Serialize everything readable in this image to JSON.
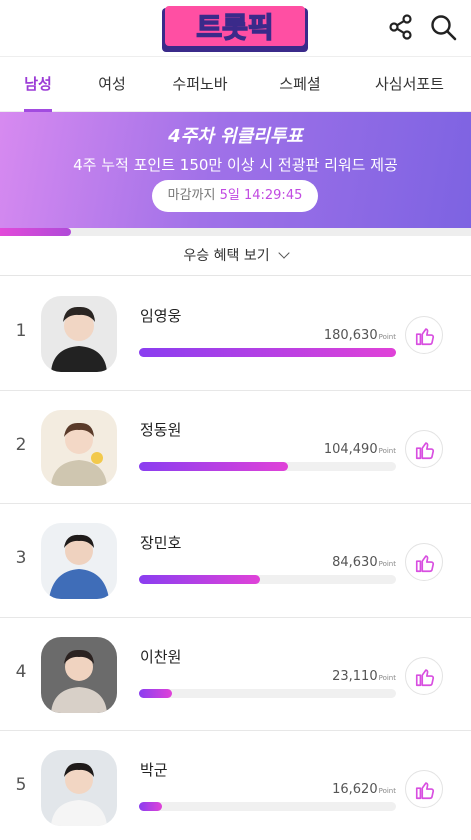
{
  "header": {
    "logo_text": "트롯픽",
    "share_icon": "share-icon",
    "search_icon": "search-icon"
  },
  "tabs": [
    {
      "label": "남성",
      "active": true
    },
    {
      "label": "여성",
      "active": false
    },
    {
      "label": "수퍼노바",
      "active": false
    },
    {
      "label": "스페셜",
      "active": false
    },
    {
      "label": "사심서포트",
      "active": false
    }
  ],
  "banner": {
    "title": "4주차 위클리투표",
    "subtitle": "4주 누적 포인트 150만 이상 시 전광판 리워드 제공",
    "deadline_label": "마감까지",
    "deadline_time": "5일 14:29:45",
    "progress": 0.15
  },
  "benefit": {
    "label": "우승 혜택 보기",
    "icon": "chevron-down-icon"
  },
  "ranking": [
    {
      "rank": "1",
      "name": "임영웅",
      "points": "180,630",
      "unit": "Point",
      "share": 1.0
    },
    {
      "rank": "2",
      "name": "정동원",
      "points": "104,490",
      "unit": "Point",
      "share": 0.58
    },
    {
      "rank": "3",
      "name": "장민호",
      "points": "84,630",
      "unit": "Point",
      "share": 0.47
    },
    {
      "rank": "4",
      "name": "이찬원",
      "points": "23,110",
      "unit": "Point",
      "share": 0.13
    },
    {
      "rank": "5",
      "name": "박군",
      "points": "16,620",
      "unit": "Point",
      "share": 0.09
    }
  ],
  "colors": {
    "accent": "#a24be0",
    "bar_start": "#8a3ef0",
    "bar_end": "#e042d8",
    "vote": "#d84ee0"
  }
}
